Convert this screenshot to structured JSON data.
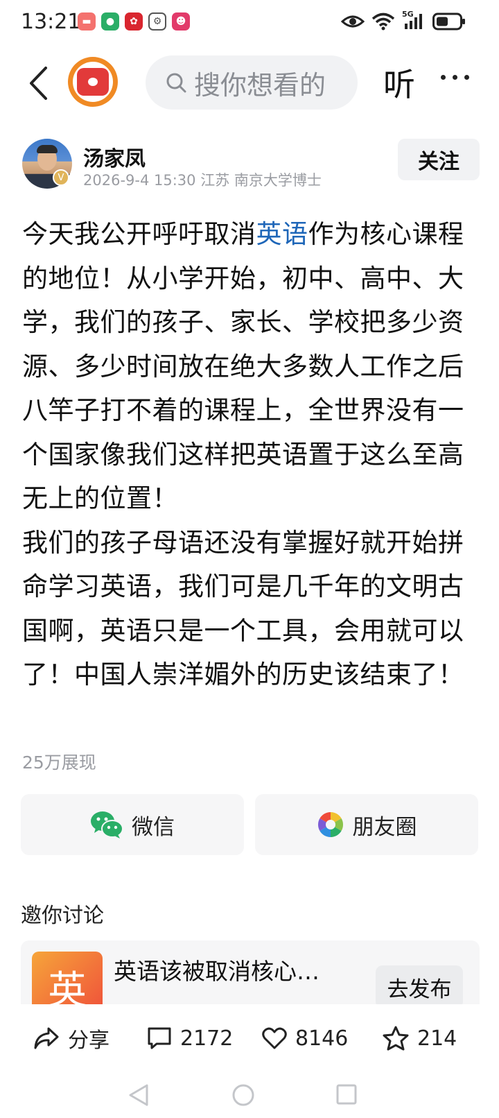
{
  "status_bar": {
    "time": "13:21",
    "network": "5G"
  },
  "top_bar": {
    "search_placeholder": "搜你想看的",
    "listen_label": "听"
  },
  "author": {
    "name": "汤家凤",
    "meta": "2026-9-4 15:30  江苏  南京大学博士",
    "verified_mark": "V",
    "follow_label": "关注"
  },
  "post": {
    "text_before_link": "今天我公开呼吁取消",
    "link_text": "英语",
    "text_after_link": "作为核心课程的地位！从小学开始，初中、高中、大学，我们的孩子、家长、学校把多少资源、多少时间放在绝大多数人工作之后八竿子打不着的课程上，全世界没有一个国家像我们这样把英语置于这么至高无上的位置！",
    "paragraph_2": "我们的孩子母语还没有掌握好就开始拼命学习英语，我们可是几千年的文明古国啊，英语只是一个工具，会用就可以了！中国人崇洋媚外的历史该结束了！",
    "views": "25万展现"
  },
  "share": {
    "wechat_label": "微信",
    "moments_label": "朋友圈"
  },
  "discussion": {
    "title": "邀你讨论",
    "topic_thumb_char": "英",
    "topic_title": "英语该被取消核心…",
    "publish_label": "去发布"
  },
  "actions": {
    "share_label": "分享",
    "comments": "2172",
    "likes": "8146",
    "favorites": "214"
  },
  "colors": {
    "link": "#1e66b8",
    "logo_orange": "#f08a24",
    "wechat_green": "#2aae67"
  }
}
